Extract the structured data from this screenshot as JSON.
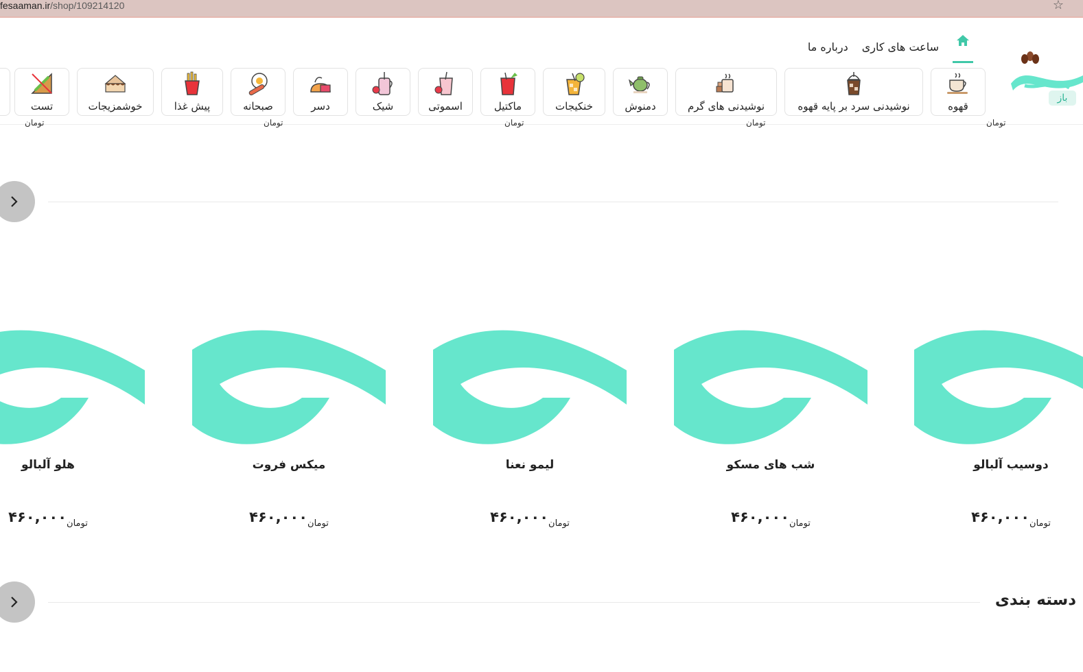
{
  "browser": {
    "url_host": "fesaaman.ir",
    "url_path": "/shop/109214120"
  },
  "header": {
    "open_badge": "باز",
    "nav": {
      "home_icon": "home-icon",
      "hours": "ساعت های کاری",
      "about": "درباره ما"
    },
    "categories": [
      {
        "label": "قهوه",
        "icon": "coffee-cup-icon"
      },
      {
        "label": "نوشیدنی سرد بر پایه قهوه",
        "icon": "iced-coffee-icon"
      },
      {
        "label": "نوشیدنی های گرم",
        "icon": "hot-drink-icon"
      },
      {
        "label": "دمنوش",
        "icon": "teapot-icon"
      },
      {
        "label": "خنکیجات",
        "icon": "cold-drink-icon"
      },
      {
        "label": "ماکتیل",
        "icon": "mocktail-icon"
      },
      {
        "label": "اسموتی",
        "icon": "smoothie-icon"
      },
      {
        "label": "شیک",
        "icon": "shake-icon"
      },
      {
        "label": "دسر",
        "icon": "dessert-icon"
      },
      {
        "label": "صبحانه",
        "icon": "breakfast-icon"
      },
      {
        "label": "پیش غذا",
        "icon": "fries-icon"
      },
      {
        "label": "خوشمزیجات",
        "icon": "cake-icon"
      },
      {
        "label": "تست",
        "icon": "sandwich-icon"
      }
    ]
  },
  "peek_row": {
    "currency": "تومان"
  },
  "products": [
    {
      "name": "دوسیب آلبالو",
      "price": "۴۶۰,۰۰۰",
      "currency": "تومان"
    },
    {
      "name": "شب های مسکو",
      "price": "۴۶۰,۰۰۰",
      "currency": "تومان"
    },
    {
      "name": "لیمو نعنا",
      "price": "۴۶۰,۰۰۰",
      "currency": "تومان"
    },
    {
      "name": "میکس فروت",
      "price": "۴۶۰,۰۰۰",
      "currency": "تومان"
    },
    {
      "name": "هلو آلبالو",
      "price": "۴۶۰,۰۰۰",
      "currency": "تومان"
    }
  ],
  "next_section": {
    "title": "دسته بندی"
  },
  "colors": {
    "brand": "#66e6cc",
    "accent": "#40c8a8",
    "arrow_bg": "#c4c4c4"
  }
}
